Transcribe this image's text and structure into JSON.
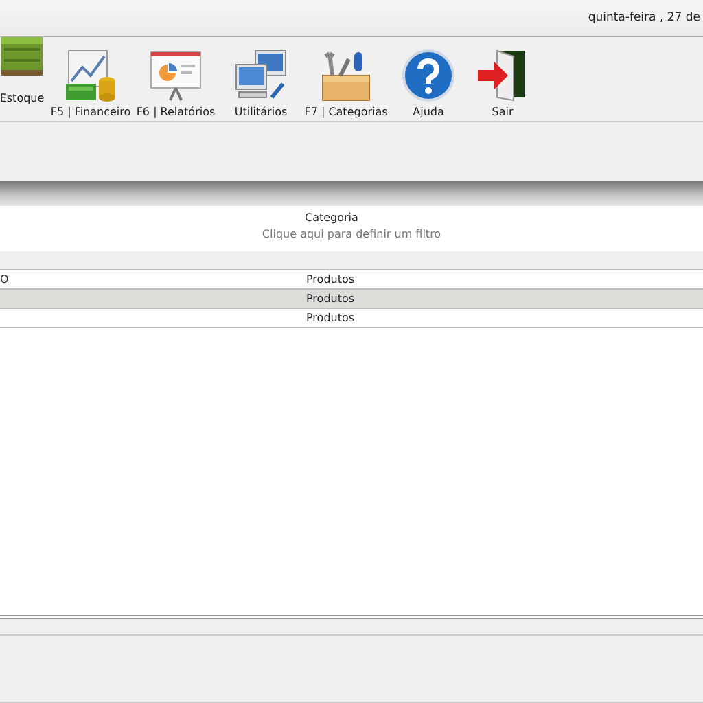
{
  "header": {
    "date": "quinta-feira , 27  de"
  },
  "toolbar": [
    {
      "label": "Estoque",
      "kind": "crate"
    },
    {
      "label": "F5 | Financeiro",
      "kind": "money"
    },
    {
      "label": "F6 | Relatórios",
      "kind": "report"
    },
    {
      "label": "Utilitários",
      "kind": "computers"
    },
    {
      "label": "F7 | Categorias",
      "kind": "tools"
    },
    {
      "label": "Ajuda",
      "kind": "help"
    },
    {
      "label": "Sair",
      "kind": "exit"
    }
  ],
  "table": {
    "columns": [
      "Categoria"
    ],
    "filter_hint": "Clique aqui para definir um filtro",
    "rows": [
      {
        "column_1": "O",
        "category": "Produtos",
        "selected": false
      },
      {
        "category": "Produtos",
        "selected": true
      },
      {
        "category": "Produtos",
        "selected": false
      }
    ]
  }
}
